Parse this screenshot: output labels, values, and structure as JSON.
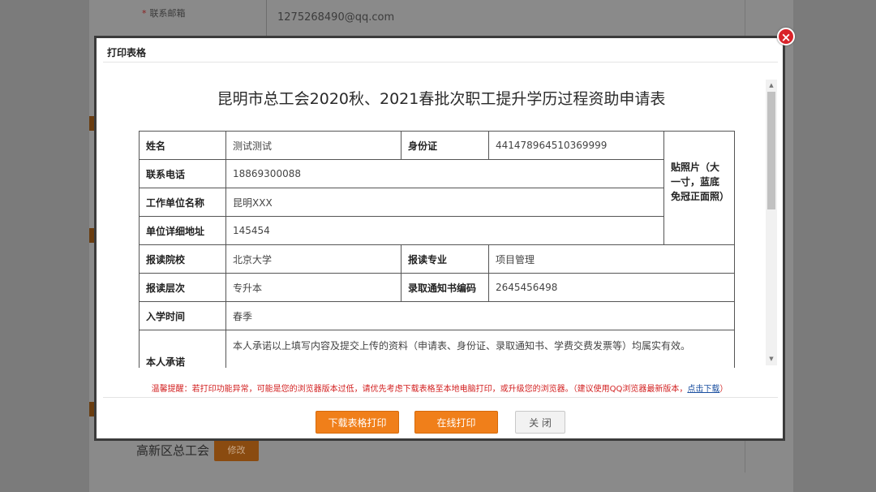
{
  "background": {
    "email_label": "联系邮箱",
    "required_mark": "*",
    "email_value": "1275268490@qq.com",
    "union_name": "高新区总工会",
    "edit_button": "修改"
  },
  "modal": {
    "title": "打印表格",
    "close_symbol": "×",
    "document_title": "昆明市总工会2020秋、2021春批次职工提升学历过程资助申请表",
    "form": {
      "name_label": "姓名",
      "name_value": "测试测试",
      "id_label": "身份证",
      "id_value": "441478964510369999",
      "photo_label": "贴照片（大一寸，蓝底免冠正面照）",
      "phone_label": "联系电话",
      "phone_value": "18869300088",
      "employer_label": "工作单位名称",
      "employer_value": "昆明XXX",
      "address_label": "单位详细地址",
      "address_value": "145454",
      "school_label": "报读院校",
      "school_value": "北京大学",
      "major_label": "报读专业",
      "major_value": "项目管理",
      "level_label": "报读层次",
      "level_value": "专升本",
      "notice_no_label": "录取通知书编码",
      "notice_no_value": "2645456498",
      "enroll_label": "入学时间",
      "enroll_value": "春季",
      "commitment_label": "本人承诺",
      "commitment_text": "本人承诺以上填写内容及提交上传的资料（申请表、身份证、录取通知书、学费交费发票等）均属实有效。"
    },
    "notice_text": "温馨提醒：若打印功能异常，可能是您的浏览器版本过低，请优先考虑下载表格至本地电脑打印，或升级您的浏览器。（建议使用QQ浏览器最新版本，",
    "notice_link": "点击下载",
    "notice_end": "）",
    "buttons": {
      "download_print": "下载表格打印",
      "online_print": "在线打印",
      "close": "关 闭"
    }
  }
}
